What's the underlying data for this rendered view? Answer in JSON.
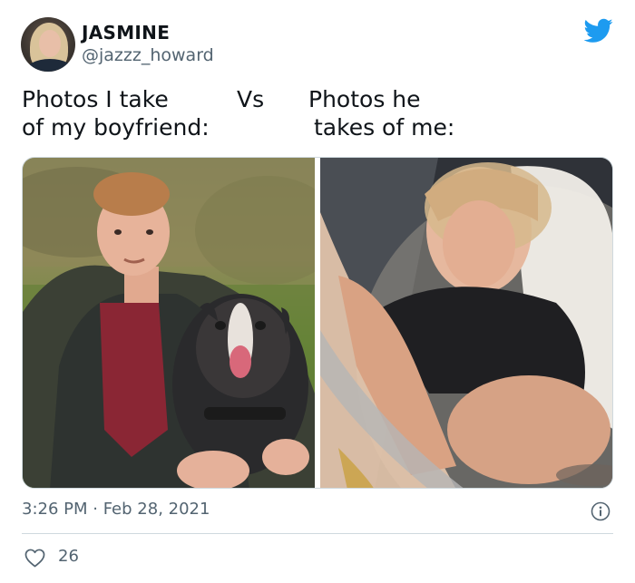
{
  "user": {
    "display_name": "JASMINE",
    "handle": "@jazzz_howard"
  },
  "tweet": {
    "text_left_line1": "Photos I take",
    "text_left_line2": "of my boyfriend:",
    "text_vs": "Vs",
    "text_right_line1": "Photos he",
    "text_right_line2": "takes of me:"
  },
  "media": {
    "left_photo": "photo-of-boyfriend-with-dog",
    "right_photo": "blurry-photo-of-girlfriend"
  },
  "meta": {
    "timestamp": "3:26 PM · Feb 28, 2021",
    "likes": "26"
  },
  "icons": {
    "brand": "twitter-bird-icon",
    "info": "info-icon",
    "like": "heart-icon"
  },
  "colors": {
    "twitter_blue": "#1d9bf0",
    "secondary_text": "#536471",
    "primary_text": "#0f1419"
  }
}
